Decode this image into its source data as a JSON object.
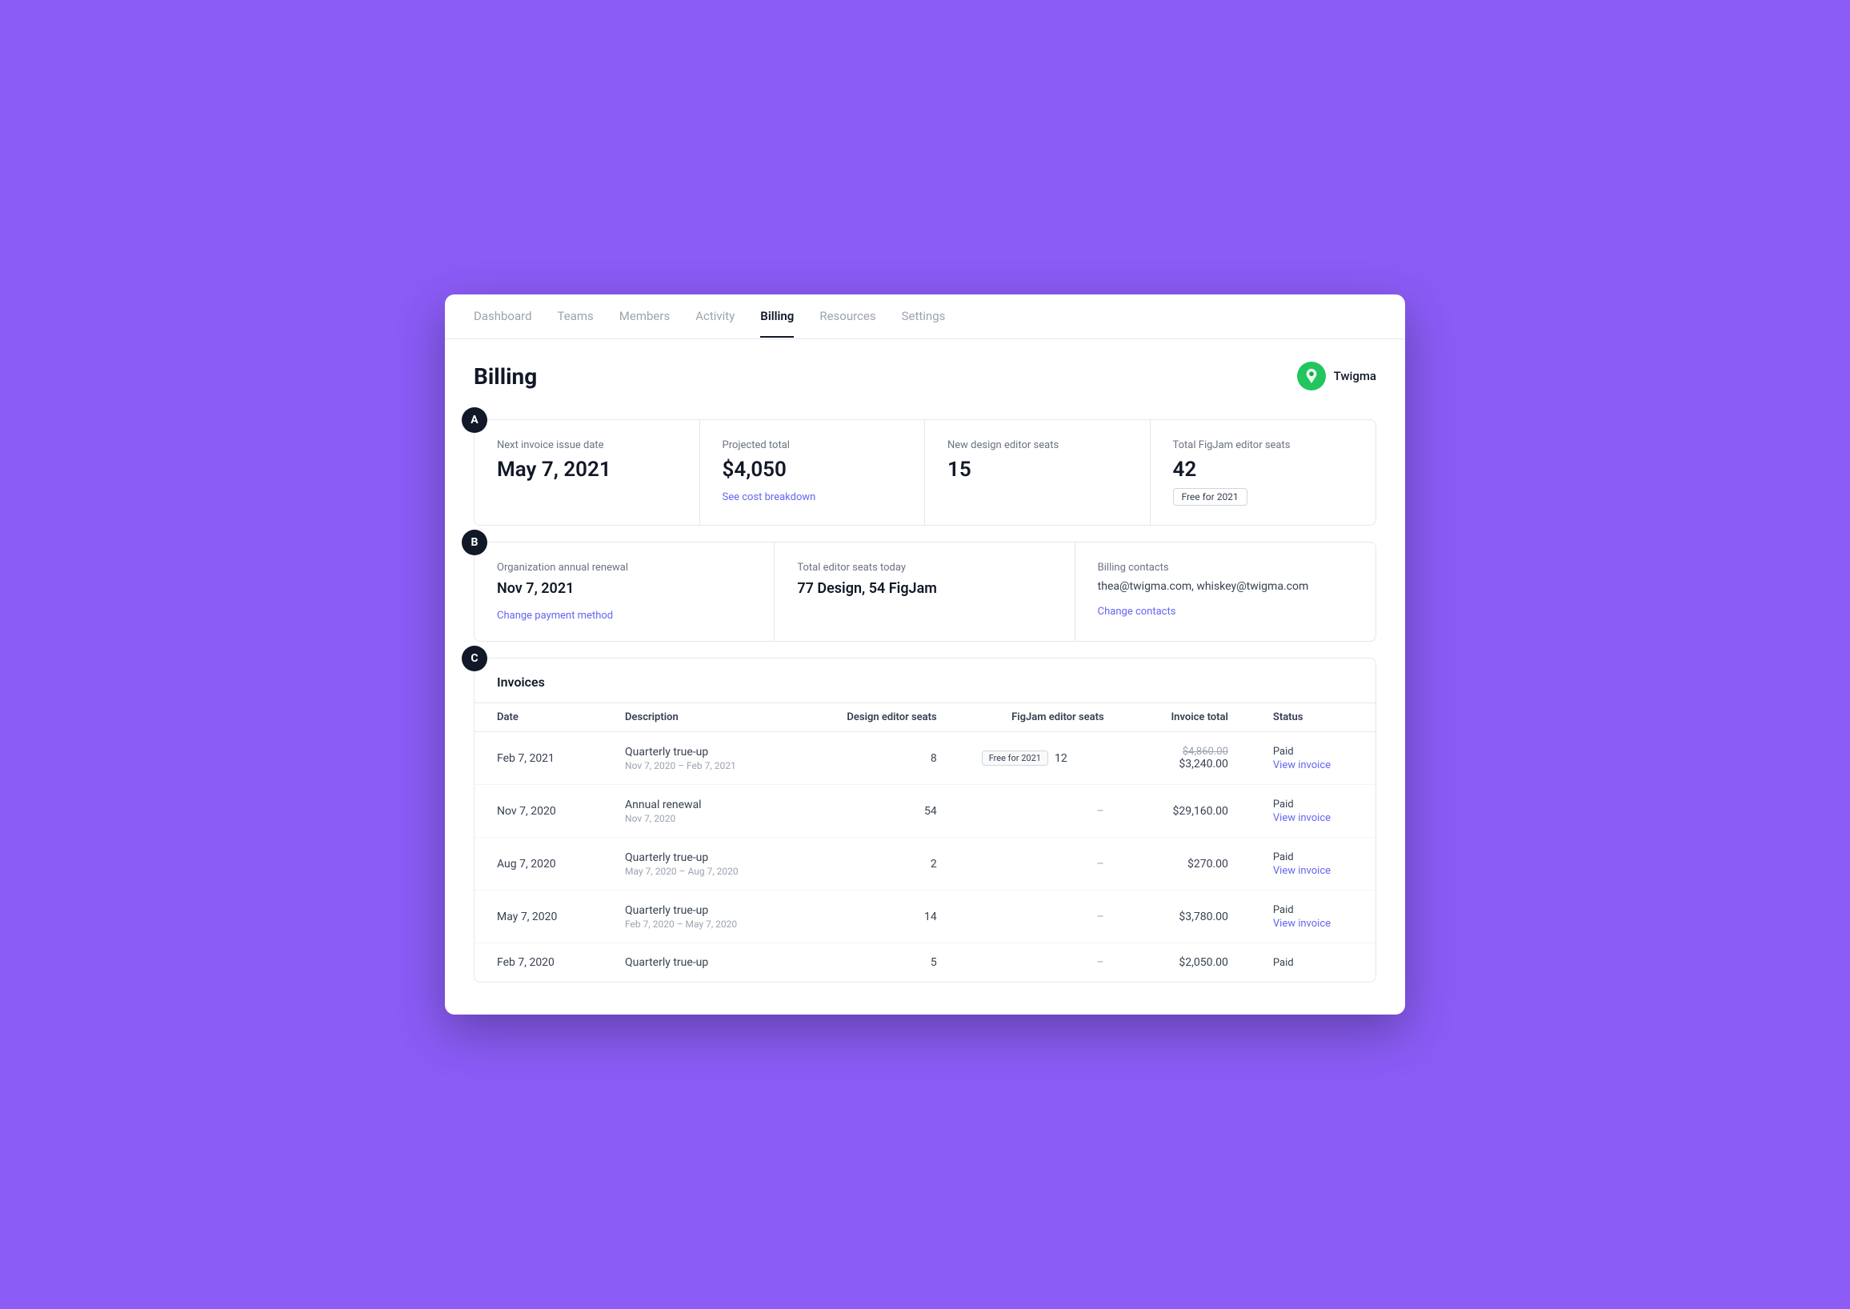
{
  "nav": {
    "items": [
      {
        "label": "Dashboard",
        "active": false
      },
      {
        "label": "Teams",
        "active": false
      },
      {
        "label": "Members",
        "active": false
      },
      {
        "label": "Activity",
        "active": false
      },
      {
        "label": "Billing",
        "active": true
      },
      {
        "label": "Resources",
        "active": false
      },
      {
        "label": "Settings",
        "active": false
      }
    ]
  },
  "header": {
    "title": "Billing",
    "org_name": "Twigma"
  },
  "section_a": {
    "badge": "A",
    "stats": [
      {
        "label": "Next invoice issue date",
        "value": "May 7, 2021",
        "link": null,
        "badge": null
      },
      {
        "label": "Projected total",
        "value": "$4,050",
        "link": "See cost breakdown",
        "badge": null
      },
      {
        "label": "New design editor seats",
        "value": "15",
        "link": null,
        "badge": null
      },
      {
        "label": "Total FigJam editor seats",
        "value": "42",
        "link": null,
        "badge": "Free for 2021"
      }
    ]
  },
  "section_b": {
    "badge": "B",
    "cells": [
      {
        "label": "Organization annual renewal",
        "value": "Nov 7, 2021",
        "sub": null,
        "link": "Change payment method"
      },
      {
        "label": "Total editor seats today",
        "value": "77 Design, 54 FigJam",
        "sub": null,
        "link": null
      },
      {
        "label": "Billing contacts",
        "value": "thea@twigma.com, whiskey@twigma.com",
        "sub": null,
        "link": "Change contacts"
      }
    ]
  },
  "invoices": {
    "badge": "C",
    "title": "Invoices",
    "columns": [
      {
        "label": "Date",
        "align": "left"
      },
      {
        "label": "Description",
        "align": "left"
      },
      {
        "label": "Design editor seats",
        "align": "right"
      },
      {
        "label": "FigJam editor seats",
        "align": "right"
      },
      {
        "label": "Invoice total",
        "align": "right"
      },
      {
        "label": "Status",
        "align": "left"
      }
    ],
    "rows": [
      {
        "date": "Feb 7, 2021",
        "desc_main": "Quarterly true-up",
        "desc_sub": "Nov 7, 2020 – Feb 7, 2021",
        "design_seats": "8",
        "figjam_seats": "12",
        "figjam_free_badge": "Free for 2021",
        "total_strike": "$4,860.00",
        "total": "$3,240.00",
        "status": "Paid",
        "view_invoice": "View invoice"
      },
      {
        "date": "Nov 7, 2020",
        "desc_main": "Annual renewal",
        "desc_sub": "Nov 7, 2020",
        "design_seats": "54",
        "figjam_seats": null,
        "figjam_free_badge": null,
        "total_strike": null,
        "total": "$29,160.00",
        "status": "Paid",
        "view_invoice": "View invoice"
      },
      {
        "date": "Aug 7, 2020",
        "desc_main": "Quarterly true-up",
        "desc_sub": "May 7, 2020 – Aug 7, 2020",
        "design_seats": "2",
        "figjam_seats": null,
        "figjam_free_badge": null,
        "total_strike": null,
        "total": "$270.00",
        "status": "Paid",
        "view_invoice": "View invoice"
      },
      {
        "date": "May 7, 2020",
        "desc_main": "Quarterly true-up",
        "desc_sub": "Feb 7, 2020 – May 7, 2020",
        "design_seats": "14",
        "figjam_seats": null,
        "figjam_free_badge": null,
        "total_strike": null,
        "total": "$3,780.00",
        "status": "Paid",
        "view_invoice": "View invoice"
      },
      {
        "date": "Feb 7, 2020",
        "desc_main": "Quarterly true-up",
        "desc_sub": "",
        "design_seats": "5",
        "figjam_seats": null,
        "figjam_free_badge": null,
        "total_strike": null,
        "total": "$2,050.00",
        "status": "Paid",
        "view_invoice": null
      }
    ]
  }
}
